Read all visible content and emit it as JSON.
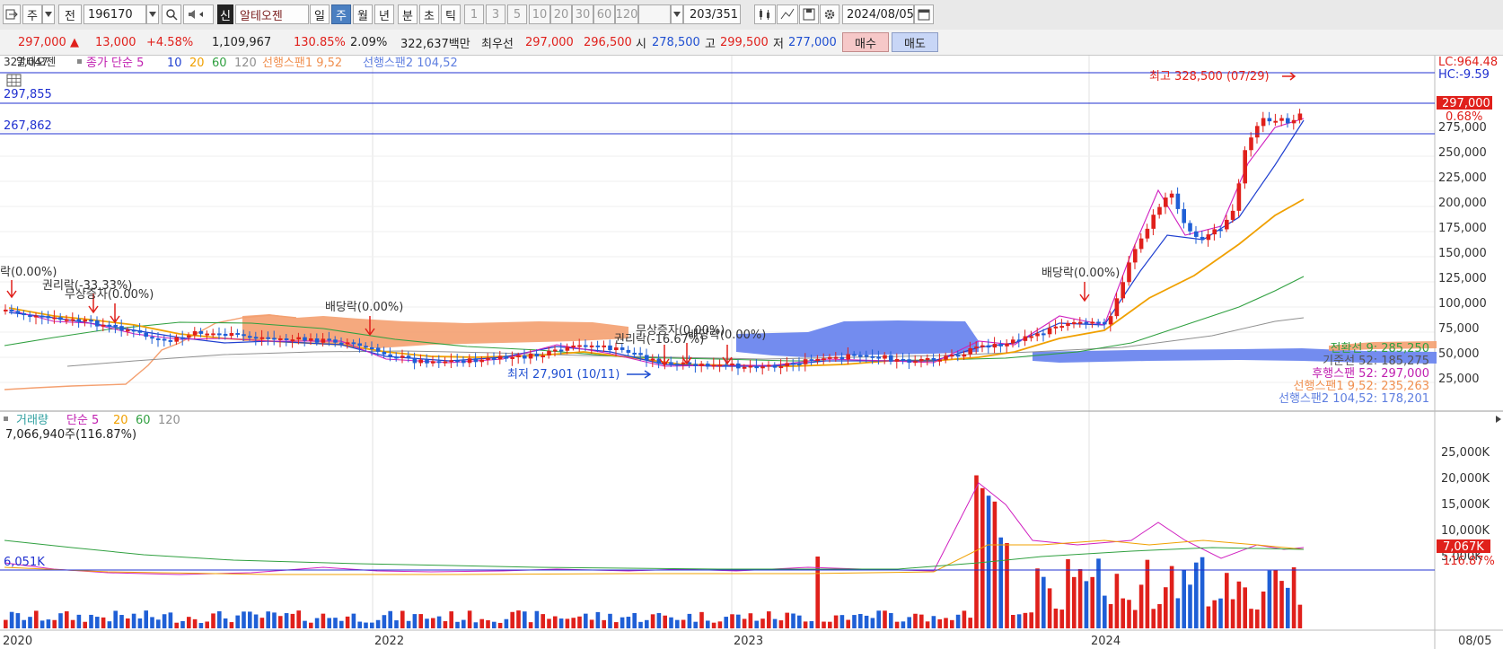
{
  "toolbar": {
    "market_btn": "주",
    "prev_btn": "전",
    "code": "196170",
    "badge": "신",
    "name": "알테오젠",
    "periods": [
      "일",
      "주",
      "월",
      "년",
      "분",
      "초",
      "틱"
    ],
    "selected_period": "주",
    "numbers": [
      "1",
      "3",
      "5",
      "10",
      "20",
      "30",
      "60",
      "120"
    ],
    "count": "203",
    "count_total": "/351",
    "date": "2024/08/05"
  },
  "quote": {
    "price": "297,000",
    "change_arrow": "▲",
    "change": "13,000",
    "change_pct": "+4.58%",
    "volume": "1,109,967",
    "volume_ratio": "130.85%",
    "turnover": "2.09%",
    "amount": "322,637백만",
    "best_label": "최우선",
    "ask": "297,000",
    "bid": "296,500",
    "open_label": "시",
    "open": "278,500",
    "high_label": "고",
    "high": "299,500",
    "low_label": "저",
    "low": "277,000",
    "buy_label": "매수",
    "sell_label": "매도"
  },
  "price_panel": {
    "legend": {
      "overlay": "327,047",
      "name": "알테오젠",
      "close_ma": "종가 단순 5",
      "ma10": "10",
      "ma20": "20",
      "ma60": "60",
      "ma120": "120",
      "span1": "선행스팬1 9,52",
      "span2": "선행스팬2 104,52"
    },
    "hlines": [
      "297,855",
      "267,862"
    ],
    "right_top": [
      "LC:964.48",
      "HC:-9.59"
    ],
    "last_price_tag": "297,000",
    "last_pct": "0.68%",
    "axis": [
      "275,000",
      "250,000",
      "225,000",
      "200,000",
      "175,000",
      "150,000",
      "125,000",
      "100,000",
      "75,000",
      "50,000",
      "25,000"
    ],
    "ichimoku_labels": [
      "전환선 9: 285,250",
      "기준선 52: 185,275",
      "후행스팬 52: 297,000",
      "선행스팬1 9,52: 235,263",
      "선행스팬2 104,52: 178,201"
    ],
    "events": [
      "락(0.00%)",
      "권리락(-33.33%)",
      "무상증자(0.00%)",
      "배당락(0.00%)",
      "무상증자(0.00%)",
      "권리락(-16.67%)",
      "배당락(0.00%)",
      "배당락(0.00%)"
    ],
    "high_note": "최고 328,500 (07/29)",
    "low_note": "최저 27,901 (10/11)"
  },
  "volume_panel": {
    "legend": {
      "name": "거래량",
      "ma": "단순 5",
      "ma20": "20",
      "ma60": "60",
      "ma120": "120"
    },
    "current": "7,066,940주(116.87%)",
    "left_tag": "6,051K",
    "axis": [
      "25,000K",
      "20,000K",
      "15,000K",
      "10,000K",
      "5,000K"
    ],
    "last_tag": "7,067K",
    "last_pct": "116.87%"
  },
  "x_axis": [
    "2020",
    "2022",
    "2023",
    "2024",
    "08/05"
  ],
  "colors": {
    "up": "#e0201b",
    "down": "#1f5fd6",
    "ma5": "#d020c0",
    "ma10": "#2040d0",
    "ma20": "#f0a000",
    "ma60": "#30a040",
    "ma120": "#909090",
    "cloud_up": "#f4a070",
    "cloud_down": "#6080f0"
  }
}
